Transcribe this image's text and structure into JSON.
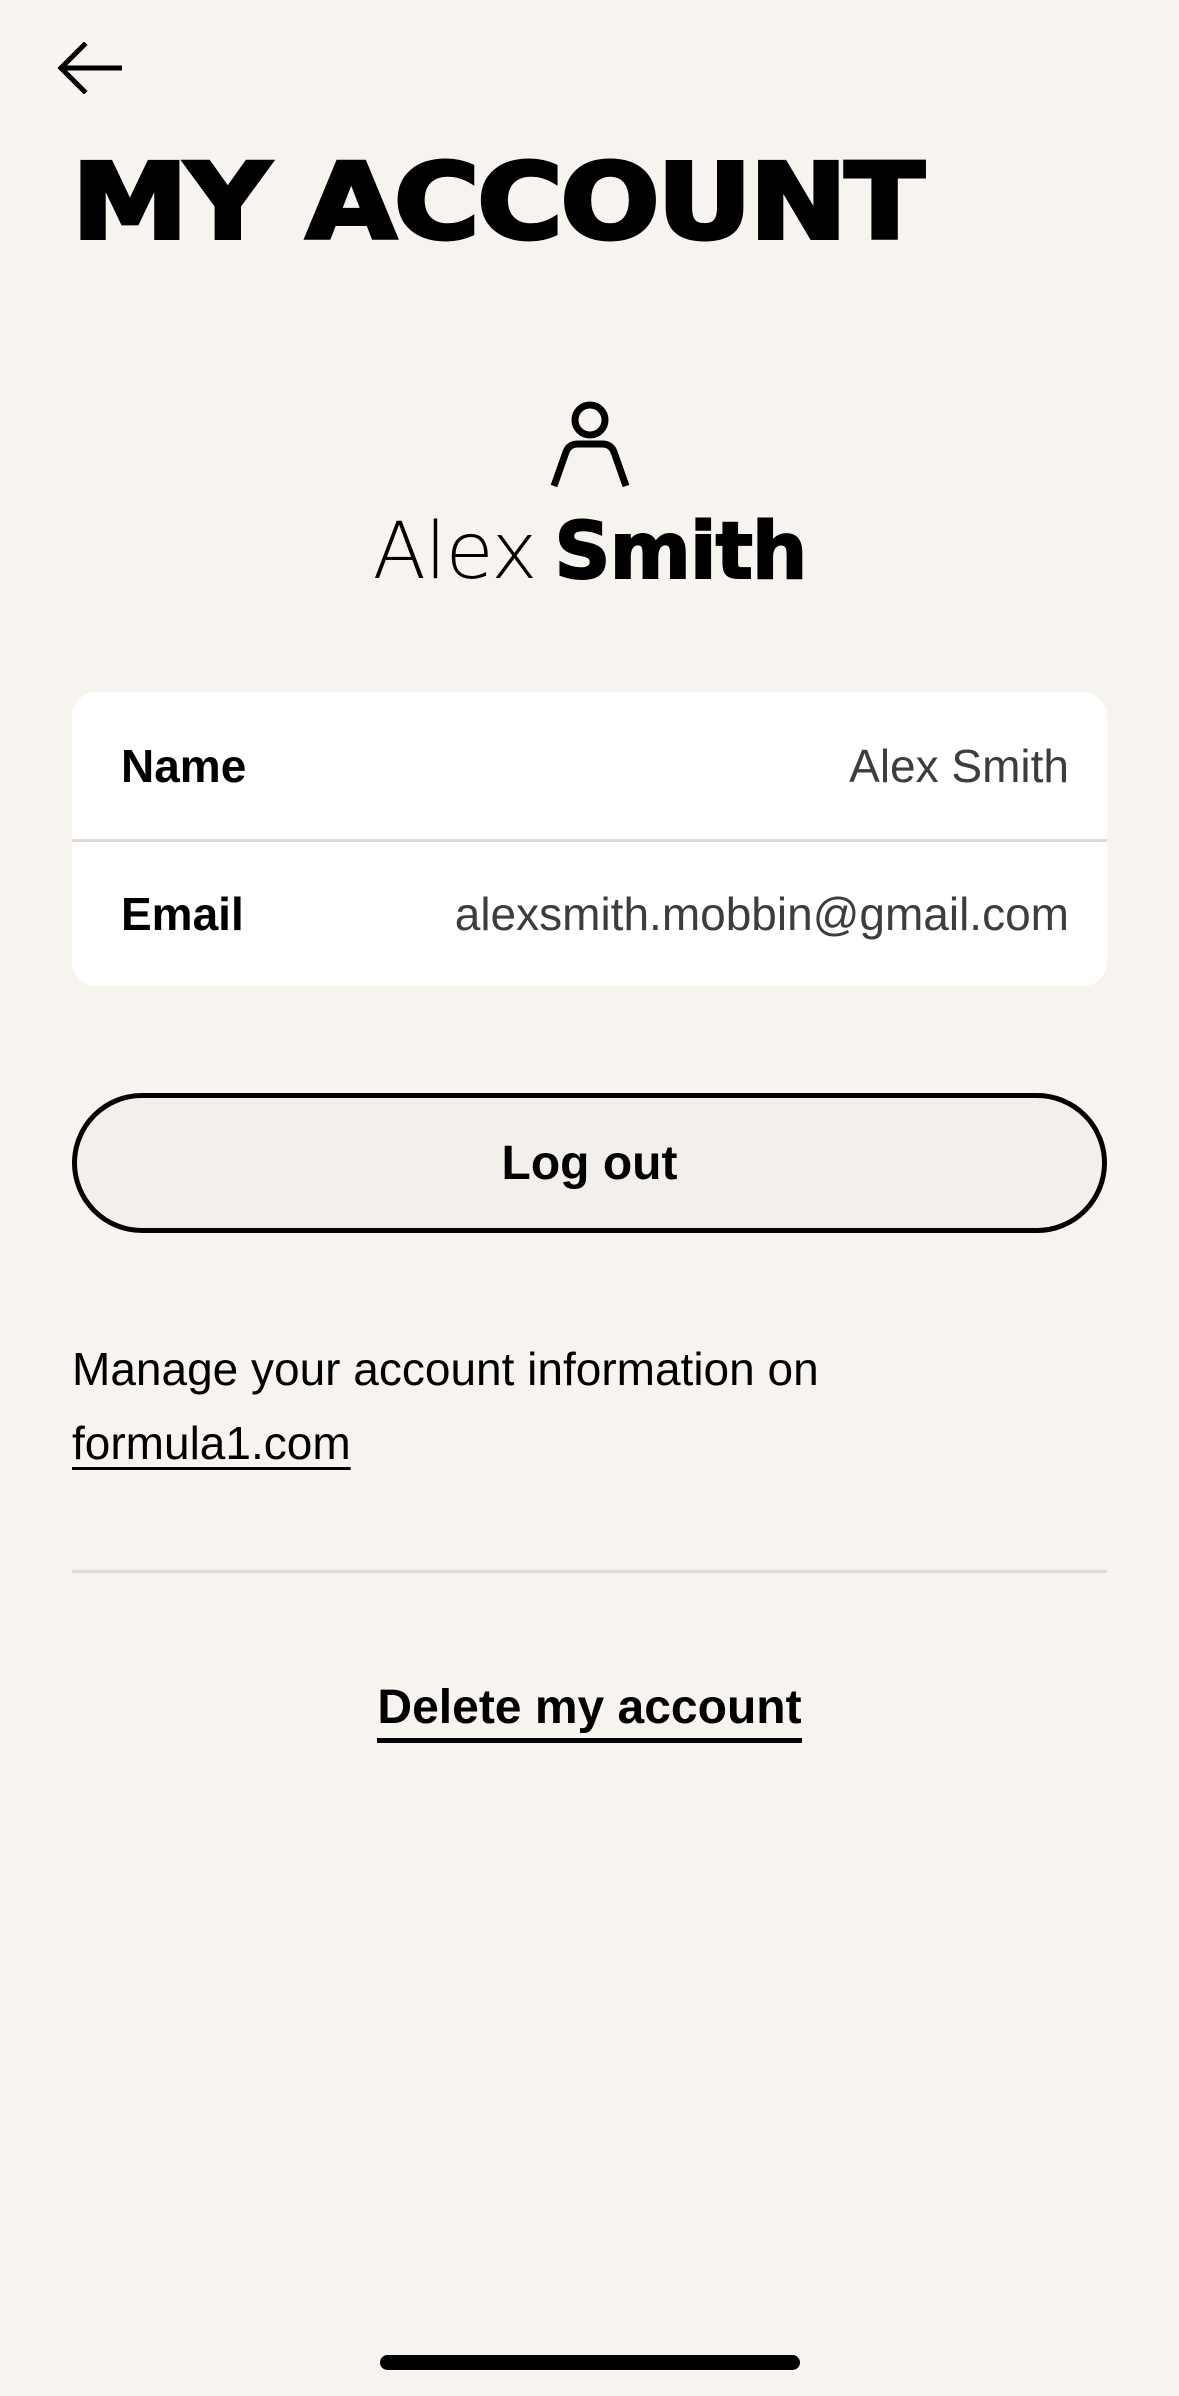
{
  "header": {
    "back_icon": "arrow-left-icon",
    "title": "MY ACCOUNT"
  },
  "profile": {
    "avatar_icon": "user-icon",
    "first_name": "Alex",
    "last_name": "Smith"
  },
  "account_info": [
    {
      "label": "Name",
      "value": "Alex Smith"
    },
    {
      "label": "Email",
      "value": "alexsmith.mobbin@gmail.com"
    }
  ],
  "actions": {
    "logout_label": "Log out",
    "manage_text": "Manage your account information on",
    "manage_link": "formula1.com",
    "delete_label": "Delete my account"
  },
  "colors": {
    "background": "#f7f4f0",
    "card": "#ffffff",
    "text": "#000000",
    "secondary_text": "#3d3d3d"
  }
}
